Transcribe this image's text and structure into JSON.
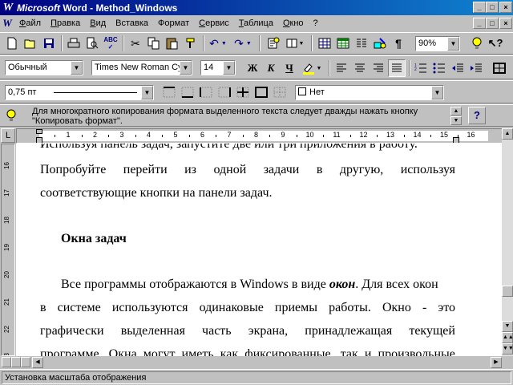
{
  "window": {
    "logo": "W",
    "app_name": "Microsoft",
    "title_rest": " Word - Method_Windows",
    "minimize": "_",
    "maximize": "□",
    "close": "×"
  },
  "menu": {
    "items": [
      {
        "label": "Файл",
        "u": "Ф",
        "rest": "айл"
      },
      {
        "label": "Правка",
        "u": "П",
        "rest": "равка"
      },
      {
        "label": "Вид",
        "u": "В",
        "rest": "ид"
      },
      {
        "label": "Вставка",
        "u": "",
        "rest": "Вставка"
      },
      {
        "label": "Формат",
        "u": "",
        "rest": "Формат"
      },
      {
        "label": "Сервис",
        "u": "С",
        "rest": "ервис"
      },
      {
        "label": "Таблица",
        "u": "Т",
        "rest": "аблица"
      },
      {
        "label": "Окно",
        "u": "О",
        "rest": "кно"
      },
      {
        "label": "?",
        "u": "",
        "rest": "?"
      }
    ]
  },
  "standard_toolbar": {
    "zoom": "90%"
  },
  "format_toolbar": {
    "style": "Обычный",
    "font": "Times New Roman Cy",
    "size": "14",
    "bold": "Ж",
    "italic": "К",
    "underline": "Ч"
  },
  "borders_toolbar": {
    "line_width": "0,75 пт",
    "shading": "Нет"
  },
  "tip": {
    "text": "Для многократного копирования формата выделенного текста следует дважды нажать кнопку \"Копировать формат\"."
  },
  "ruler": {
    "h_ticks": [
      "1",
      "2",
      "3",
      "4",
      "5",
      "6",
      "7",
      "8",
      "9",
      "10",
      "11",
      "12",
      "13",
      "14",
      "15",
      "16"
    ],
    "v_ticks": [
      "16",
      "17",
      "18",
      "19",
      "20",
      "21",
      "22",
      "23"
    ]
  },
  "document": {
    "line0": "Используя панель задач, запустите две или три приложения в работу.",
    "line1": [
      "Попробуйте",
      "перейти",
      "из",
      "одной",
      "задачи",
      "в",
      "другую,",
      "используя"
    ],
    "line2": "соответствующие кнопки на панели задач.",
    "heading": "Окна задач",
    "p2_line1_a": "Все программы отображаются в Windows в виде ",
    "p2_line1_b": "окон",
    "p2_line1_c": ". Для всех окон",
    "p2_line2": [
      "в",
      "системе",
      "используются",
      "одинаковые",
      "приемы",
      "работы.",
      "Окно",
      "-",
      "это"
    ],
    "p2_line3": [
      "графически",
      "выделенная",
      "часть",
      "экрана,",
      "принадлежащая",
      "текущей"
    ],
    "p2_line4": [
      "программе.",
      "Окна",
      "могут",
      "иметь",
      "как",
      "фиксированные,",
      "так",
      "и",
      "произвольные"
    ]
  },
  "status": {
    "text": "Установка масштаба отображения"
  }
}
